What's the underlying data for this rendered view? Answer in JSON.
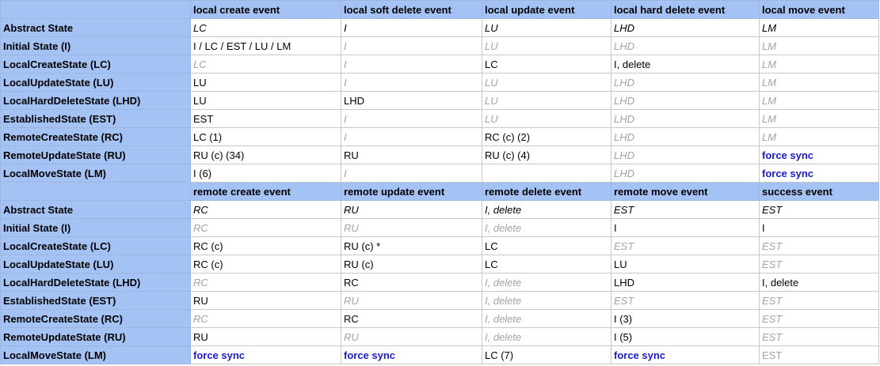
{
  "table1": {
    "headers": [
      "",
      "local create event",
      "local soft delete event",
      "local update event",
      "local hard delete event",
      "local move event"
    ],
    "rows": [
      {
        "label": "Abstract State",
        "cells": [
          {
            "text": "LC",
            "style": "italic"
          },
          {
            "text": "I",
            "style": "italic"
          },
          {
            "text": "LU",
            "style": "italic"
          },
          {
            "text": "LHD",
            "style": "italic"
          },
          {
            "text": "LM",
            "style": "italic"
          }
        ]
      },
      {
        "label": "Initial State (I)",
        "cells": [
          {
            "text": "I / LC / EST / LU / LM",
            "style": "normal"
          },
          {
            "text": "I",
            "style": "grey"
          },
          {
            "text": "LU",
            "style": "grey"
          },
          {
            "text": "LHD",
            "style": "grey"
          },
          {
            "text": "LM",
            "style": "grey"
          }
        ]
      },
      {
        "label": "LocalCreateState (LC)",
        "cells": [
          {
            "text": "LC",
            "style": "grey"
          },
          {
            "text": "I",
            "style": "grey"
          },
          {
            "text": "LC",
            "style": "normal"
          },
          {
            "text": "I, delete",
            "style": "normal"
          },
          {
            "text": "LM",
            "style": "grey"
          }
        ]
      },
      {
        "label": "LocalUpdateState (LU)",
        "cells": [
          {
            "text": "LU",
            "style": "normal"
          },
          {
            "text": "I",
            "style": "grey"
          },
          {
            "text": "LU",
            "style": "grey"
          },
          {
            "text": "LHD",
            "style": "grey"
          },
          {
            "text": "LM",
            "style": "grey"
          }
        ]
      },
      {
        "label": "LocalHardDeleteState (LHD)",
        "cells": [
          {
            "text": "LU",
            "style": "normal"
          },
          {
            "text": "LHD",
            "style": "normal"
          },
          {
            "text": "LU",
            "style": "grey"
          },
          {
            "text": "LHD",
            "style": "grey"
          },
          {
            "text": "LM",
            "style": "grey"
          }
        ]
      },
      {
        "label": "EstablishedState (EST)",
        "cells": [
          {
            "text": "EST",
            "style": "normal"
          },
          {
            "text": "I",
            "style": "grey"
          },
          {
            "text": "LU",
            "style": "grey"
          },
          {
            "text": "LHD",
            "style": "grey"
          },
          {
            "text": "LM",
            "style": "grey"
          }
        ]
      },
      {
        "label": "RemoteCreateState (RC)",
        "cells": [
          {
            "text": "LC (1)",
            "style": "normal"
          },
          {
            "text": "I",
            "style": "grey"
          },
          {
            "text": "RC (c) (2)",
            "style": "normal"
          },
          {
            "text": "LHD",
            "style": "grey"
          },
          {
            "text": "LM",
            "style": "grey"
          }
        ]
      },
      {
        "label": "RemoteUpdateState (RU)",
        "cells": [
          {
            "text": "RU (c) (34)",
            "style": "normal"
          },
          {
            "text": "RU",
            "style": "normal"
          },
          {
            "text": "RU (c) (4)",
            "style": "normal"
          },
          {
            "text": "LHD",
            "style": "grey"
          },
          {
            "text": "force sync",
            "style": "force"
          }
        ]
      },
      {
        "label": "LocalMoveState (LM)",
        "cells": [
          {
            "text": "I (6)",
            "style": "normal"
          },
          {
            "text": "I",
            "style": "grey"
          },
          {
            "text": "",
            "style": "normal"
          },
          {
            "text": "LHD",
            "style": "grey"
          },
          {
            "text": "force sync",
            "style": "force"
          }
        ]
      }
    ]
  },
  "table2": {
    "headers": [
      "",
      "remote create event",
      "remote update event",
      "remote delete event",
      "remote move event",
      "success event"
    ],
    "rows": [
      {
        "label": "Abstract State",
        "cells": [
          {
            "text": "RC",
            "style": "italic"
          },
          {
            "text": "RU",
            "style": "italic"
          },
          {
            "text": "I, delete",
            "style": "italic"
          },
          {
            "text": "EST",
            "style": "italic"
          },
          {
            "text": "EST",
            "style": "italic"
          }
        ]
      },
      {
        "label": "Initial State (I)",
        "cells": [
          {
            "text": "RC",
            "style": "grey"
          },
          {
            "text": "RU",
            "style": "grey"
          },
          {
            "text": "I, delete",
            "style": "grey"
          },
          {
            "text": "I",
            "style": "normal"
          },
          {
            "text": "I",
            "style": "normal"
          }
        ]
      },
      {
        "label": "LocalCreateState (LC)",
        "cells": [
          {
            "text": "RC (c)",
            "style": "normal"
          },
          {
            "text": "RU (c) *",
            "style": "normal"
          },
          {
            "text": "LC",
            "style": "normal"
          },
          {
            "text": "EST",
            "style": "grey"
          },
          {
            "text": "EST",
            "style": "grey"
          }
        ]
      },
      {
        "label": "LocalUpdateState (LU)",
        "cells": [
          {
            "text": "RC (c)",
            "style": "normal"
          },
          {
            "text": "RU (c)",
            "style": "normal"
          },
          {
            "text": "LC",
            "style": "normal"
          },
          {
            "text": "LU",
            "style": "normal"
          },
          {
            "text": "EST",
            "style": "grey"
          }
        ]
      },
      {
        "label": "LocalHardDeleteState (LHD)",
        "cells": [
          {
            "text": "RC",
            "style": "grey"
          },
          {
            "text": "RC",
            "style": "normal"
          },
          {
            "text": "I, delete",
            "style": "grey"
          },
          {
            "text": "LHD",
            "style": "normal"
          },
          {
            "text": "I, delete",
            "style": "normal"
          }
        ]
      },
      {
        "label": "EstablishedState (EST)",
        "cells": [
          {
            "text": "RU",
            "style": "normal"
          },
          {
            "text": "RU",
            "style": "grey"
          },
          {
            "text": "I, delete",
            "style": "grey"
          },
          {
            "text": "EST",
            "style": "grey"
          },
          {
            "text": "EST",
            "style": "grey"
          }
        ]
      },
      {
        "label": "RemoteCreateState (RC)",
        "cells": [
          {
            "text": "RC",
            "style": "grey"
          },
          {
            "text": "RC",
            "style": "normal"
          },
          {
            "text": "I, delete",
            "style": "grey"
          },
          {
            "text": "I (3)",
            "style": "normal"
          },
          {
            "text": "EST",
            "style": "grey"
          }
        ]
      },
      {
        "label": "RemoteUpdateState (RU)",
        "cells": [
          {
            "text": "RU",
            "style": "normal"
          },
          {
            "text": "RU",
            "style": "grey"
          },
          {
            "text": "I, delete",
            "style": "grey"
          },
          {
            "text": "I (5)",
            "style": "normal"
          },
          {
            "text": "EST",
            "style": "grey"
          }
        ]
      },
      {
        "label": "LocalMoveState (LM)",
        "cells": [
          {
            "text": "force sync",
            "style": "force"
          },
          {
            "text": "force sync",
            "style": "force"
          },
          {
            "text": "LC (7)",
            "style": "normal"
          },
          {
            "text": "force sync",
            "style": "force"
          },
          {
            "text": "EST",
            "style": "greyplain"
          }
        ]
      }
    ]
  }
}
